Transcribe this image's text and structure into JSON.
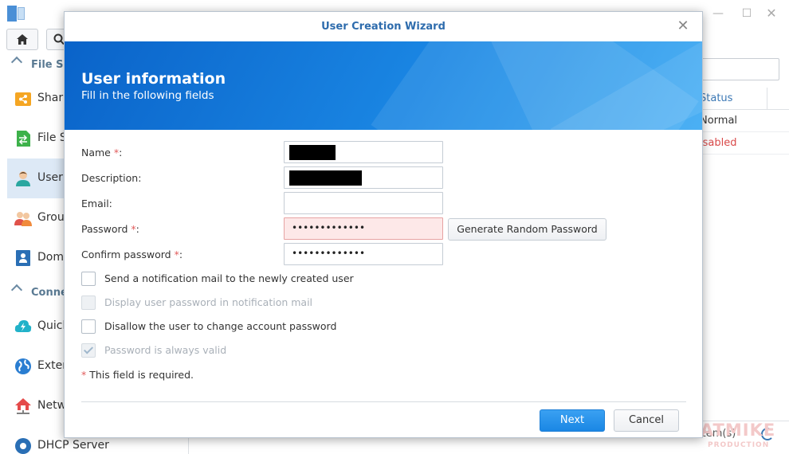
{
  "background": {
    "sidebar": {
      "sections": [
        {
          "label": "File Sh"
        },
        {
          "label": "Conne"
        }
      ],
      "items": [
        {
          "label": "Shar"
        },
        {
          "label": "File S"
        },
        {
          "label": "User"
        },
        {
          "label": "Grou"
        },
        {
          "label": "Dom"
        },
        {
          "label": "Quick"
        },
        {
          "label": "Exter"
        },
        {
          "label": "Netw"
        },
        {
          "label": "DHCP Server"
        }
      ]
    },
    "table": {
      "column": "Status",
      "rows": [
        {
          "status": "Normal",
          "color": "#333333"
        },
        {
          "status": "isabled",
          "color": "#d94a4a"
        }
      ]
    },
    "footer": {
      "items_text": "item(s)"
    },
    "watermark": {
      "line1": "FATMIKE",
      "line2": "PRODUCTION"
    }
  },
  "modal": {
    "title": "User Creation Wizard",
    "banner": {
      "title": "User information",
      "subtitle": "Fill in the following fields"
    },
    "form": {
      "name_label": "Name",
      "description_label": "Description:",
      "email_label": "Email:",
      "password_label": "Password",
      "confirm_label": "Confirm password",
      "required_mark": "*",
      "colon": ":",
      "password_value": "•••••••••••••",
      "confirm_value": "•••••••••••••",
      "generate_button": "Generate Random Password"
    },
    "options": [
      {
        "label": "Send a notification mail to the newly created user",
        "checked": false,
        "disabled": false
      },
      {
        "label": "Display user password in notification mail",
        "checked": false,
        "disabled": true
      },
      {
        "label": "Disallow the user to change account password",
        "checked": false,
        "disabled": false
      },
      {
        "label": "Password is always valid",
        "checked": true,
        "disabled": true
      }
    ],
    "required_note": "This field is required.",
    "next_button": "Next",
    "cancel_button": "Cancel"
  },
  "colors": {
    "accent": "#1a87e4",
    "title_blue": "#2e6cad",
    "required_red": "#e15b5b",
    "invalid_bg": "#fde8e8"
  }
}
